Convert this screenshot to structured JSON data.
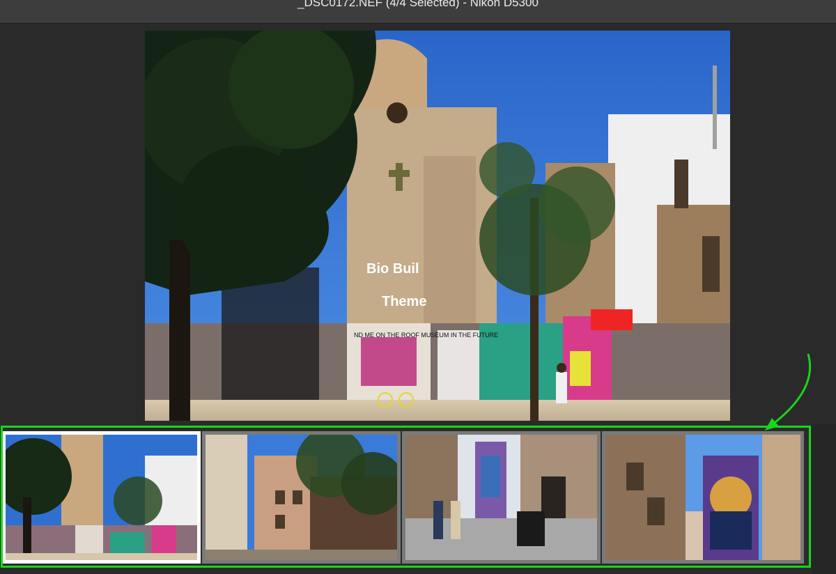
{
  "window": {
    "title": "_DSC0172.NEF (4/4 Selected)  -  Nikon D5300"
  },
  "preview": {
    "wall_text_1": "Bio Buil",
    "wall_text_2": "Theme",
    "graffiti_text": "ND ME ON THE ROOF MUSEUM IN THE FUTURE"
  },
  "filmstrip": {
    "thumbnails": [
      {
        "id": "street-church"
      },
      {
        "id": "palm-street"
      },
      {
        "id": "mural-alley"
      },
      {
        "id": "face-mural"
      }
    ]
  },
  "colors": {
    "highlight": "#17d61c",
    "sky": "#2f6fd0",
    "background": "#2b2b2b"
  }
}
